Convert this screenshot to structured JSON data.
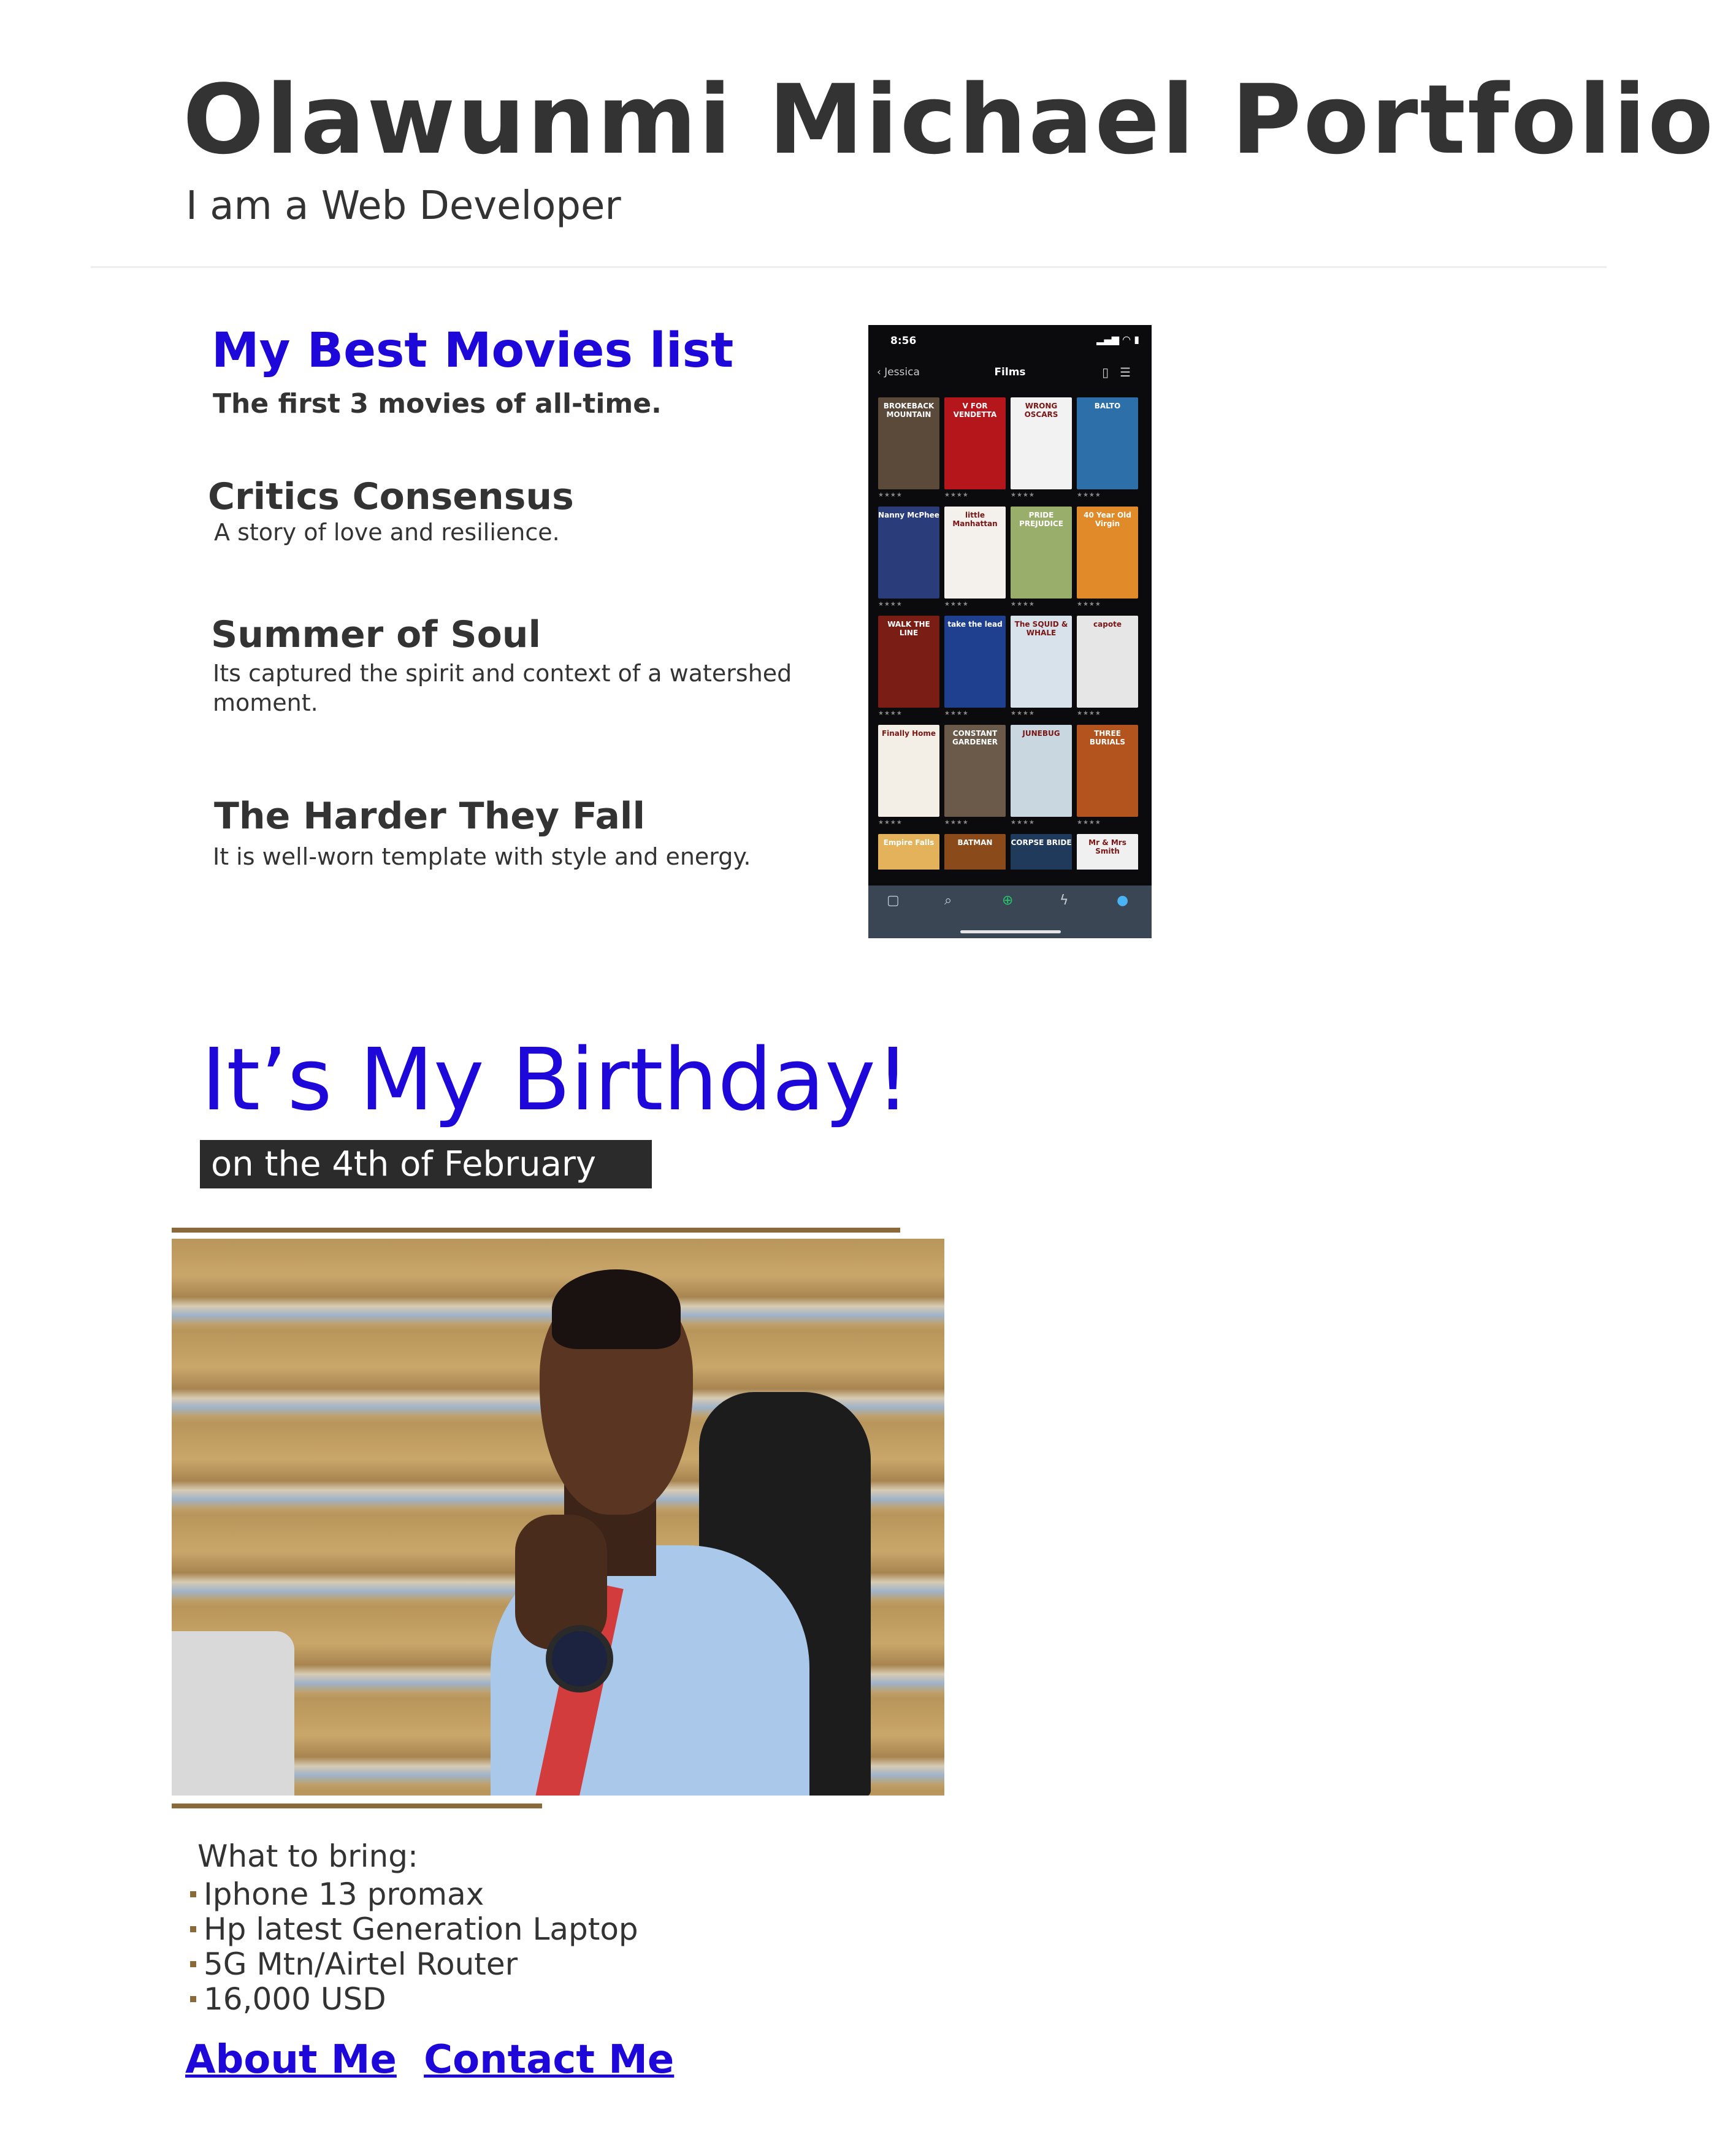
{
  "header": {
    "title": "Olawunmi Michael Portfolio",
    "subtitle": "I am a Web Developer"
  },
  "movies": {
    "heading": "My Best Movies list",
    "subheading": "The first 3 movies of all-time.",
    "items": [
      {
        "title": "Critics Consensus",
        "description": "A story of love and resilience."
      },
      {
        "title": "Summer of Soul",
        "description": "Its captured the spirit and context of a watershed moment."
      },
      {
        "title": "The Harder They Fall",
        "description": "It is well-worn template with style and energy."
      }
    ]
  },
  "phone": {
    "time": "8:56",
    "back_label": "Jessica",
    "nav_title": "Films",
    "posters": [
      {
        "label": "BROKEBACK MOUNTAIN",
        "color": "#5b4a3a"
      },
      {
        "label": "V FOR VENDETTA",
        "color": "#b5161c"
      },
      {
        "label": "WRONG OSCARS",
        "color": "#f2f2f2"
      },
      {
        "label": "BALTO",
        "color": "#2d6fa8"
      },
      {
        "label": "Nanny McPhee",
        "color": "#2a3c7a"
      },
      {
        "label": "little Manhattan",
        "color": "#f4f1ec"
      },
      {
        "label": "PRIDE PREJUDICE",
        "color": "#9aae6c"
      },
      {
        "label": "40 Year Old Virgin",
        "color": "#e08a2a"
      },
      {
        "label": "WALK THE LINE",
        "color": "#7a1d14"
      },
      {
        "label": "take the lead",
        "color": "#1f3f8f"
      },
      {
        "label": "The SQUID & WHALE",
        "color": "#d8e2ea"
      },
      {
        "label": "capote",
        "color": "#e6e6e6"
      },
      {
        "label": "Finally Home",
        "color": "#f3efe6"
      },
      {
        "label": "CONSTANT GARDENER",
        "color": "#6b5a4a"
      },
      {
        "label": "JUNEBUG",
        "color": "#c9d7e0"
      },
      {
        "label": "THREE BURIALS",
        "color": "#b3541e"
      },
      {
        "label": "Empire Falls",
        "color": "#e4b25a"
      },
      {
        "label": "BATMAN",
        "color": "#8a4a1a"
      },
      {
        "label": "CORPSE BRIDE",
        "color": "#1f3a5a"
      },
      {
        "label": "Mr & Mrs Smith",
        "color": "#f0f0f0"
      }
    ],
    "stars": "★★★★"
  },
  "birthday": {
    "title": "It’s My Birthday!",
    "date": "on the 4th of February"
  },
  "bring": {
    "heading": "What to bring:",
    "items": [
      "Iphone 13 promax",
      "Hp latest Generation Laptop",
      "5G Mtn/Airtel Router",
      "16,000 USD"
    ]
  },
  "footer": {
    "about_label": "About Me",
    "contact_label": "Contact Me"
  },
  "colors": {
    "accent_blue": "#1d07d9",
    "text_dark": "#333333",
    "brown_rule": "#8a6a3b"
  }
}
